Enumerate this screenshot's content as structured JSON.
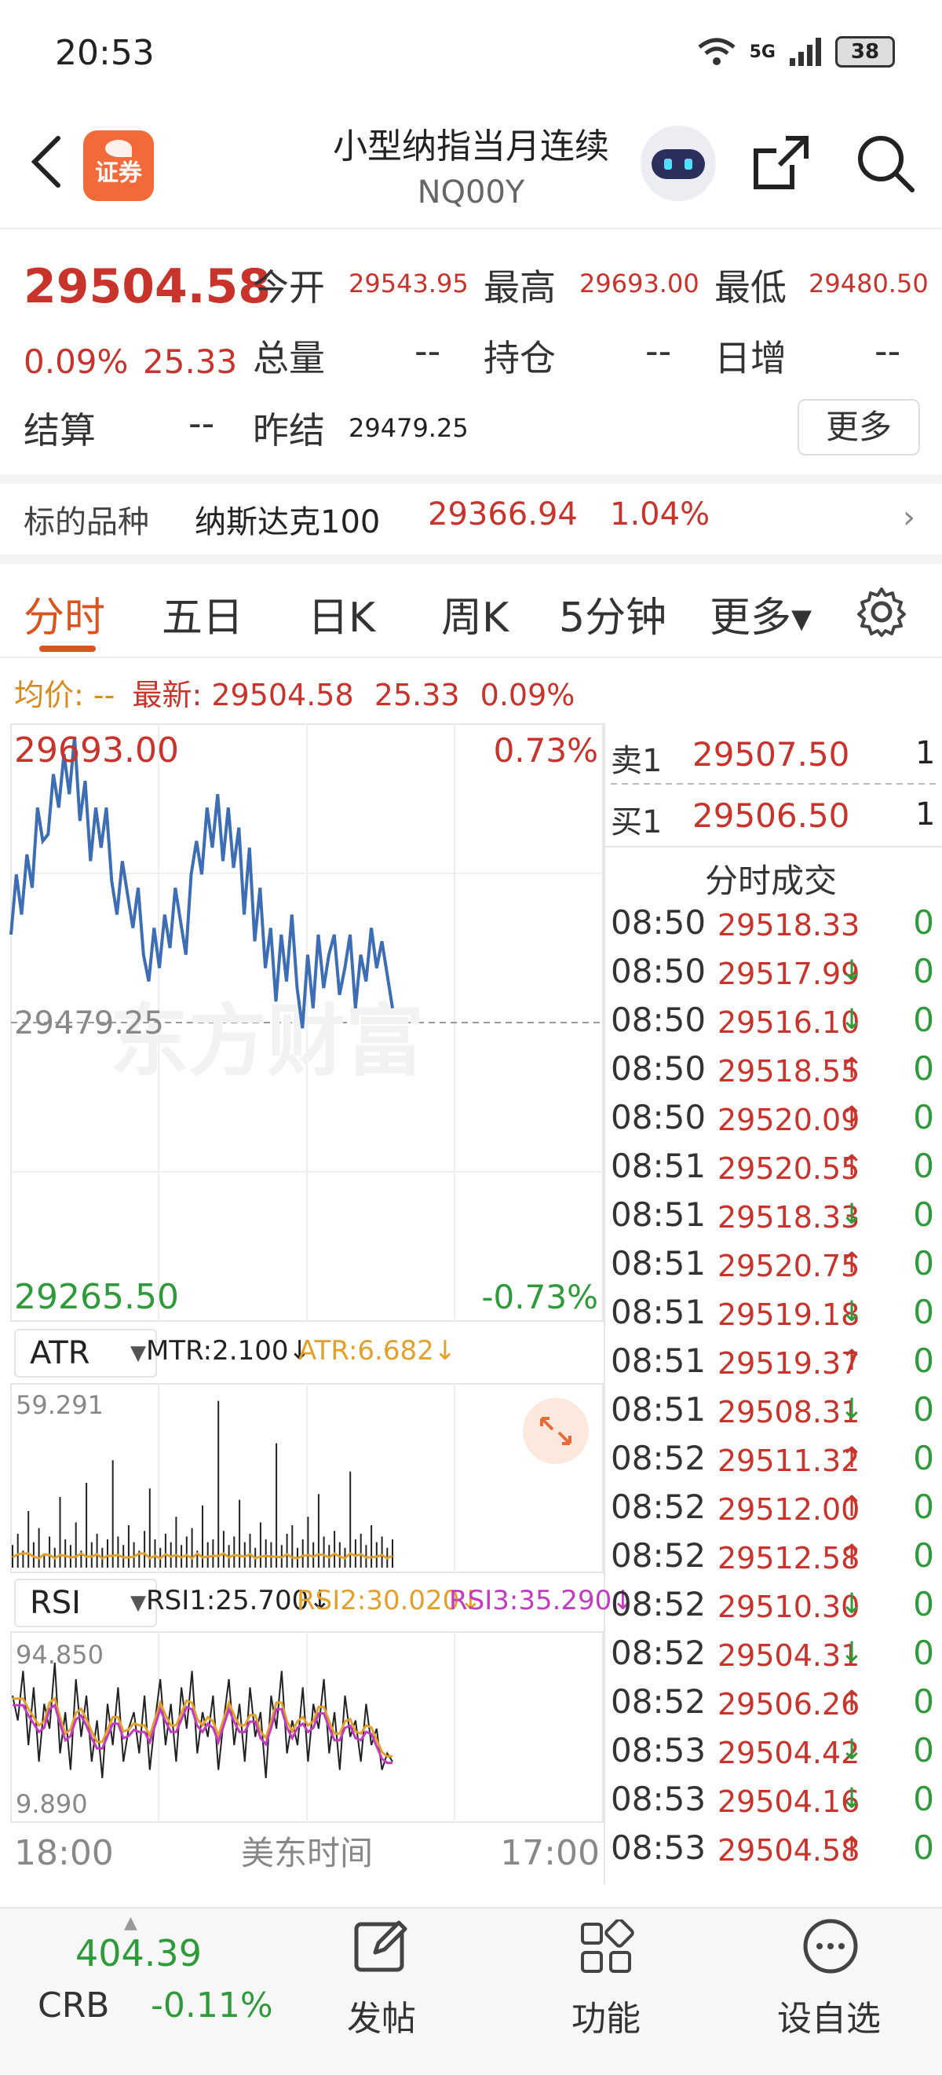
{
  "status_bar": {
    "time": "20:53",
    "network": "5G",
    "battery": "38"
  },
  "header": {
    "title": "小型纳指当月连续",
    "code": "NQ00Y",
    "app_logo_text": "证券"
  },
  "quote": {
    "price": "29504.58",
    "change_pct": "0.09%",
    "change": "25.33",
    "open_label": "今开",
    "open": "29543.95",
    "high_label": "最高",
    "high": "29693.00",
    "low_label": "最低",
    "low": "29480.50",
    "volume_label": "总量",
    "volume": "--",
    "oi_label": "持仓",
    "oi": "--",
    "daily_inc_label": "日增",
    "daily_inc": "--",
    "settle_label": "结算",
    "settle": "--",
    "prev_settle_label": "昨结",
    "prev_settle": "29479.25",
    "more_button": "更多"
  },
  "underlying": {
    "label": "标的品种",
    "name": "纳斯达克100",
    "price": "29366.94",
    "pct": "1.04%"
  },
  "tabs": [
    {
      "label": "分时",
      "active": true
    },
    {
      "label": "五日"
    },
    {
      "label": "日K"
    },
    {
      "label": "周K"
    },
    {
      "label": "5分钟"
    },
    {
      "label": "更多▾"
    }
  ],
  "info_line": {
    "avg_label": "均价:",
    "avg_value": "--",
    "latest_label": "最新:",
    "latest_value": "29504.58",
    "change": "25.33",
    "pct": "0.09%"
  },
  "chart": {
    "max_label": "29693.00",
    "max_pct": "0.73%",
    "ref_label": "29479.25",
    "min_label": "29265.50",
    "min_pct": "-0.73%",
    "watermark": "东方财富",
    "time_start": "18:00",
    "time_mid": "美东时间",
    "time_end": "17:00"
  },
  "chart_data": {
    "type": "line",
    "title": "",
    "xlabel": "美东时间",
    "ylim": [
      29265.5,
      29693.0
    ],
    "reference": 29479.25,
    "x_ticks": [
      "18:00",
      "17:00"
    ],
    "series": [
      {
        "values": [
          29545,
          29590,
          29560,
          29605,
          29580,
          29640,
          29615,
          29620,
          29665,
          29640,
          29680,
          29650,
          29693,
          29630,
          29660,
          29600,
          29640,
          29610,
          29640,
          29585,
          29560,
          29600,
          29575,
          29550,
          29580,
          29530,
          29510,
          29550,
          29520,
          29560,
          29535,
          29580,
          29555,
          29530,
          29590,
          29615,
          29590,
          29640,
          29610,
          29650,
          29600,
          29640,
          29595,
          29625,
          29560,
          29610,
          29540,
          29580,
          29520,
          29550,
          29495,
          29545,
          29510,
          29560,
          29505,
          29475,
          29530,
          29490,
          29545,
          29505,
          29530,
          29545,
          29500,
          29520,
          29545,
          29490,
          29530,
          29510,
          29550,
          29520,
          29540,
          29515,
          29490
        ]
      }
    ]
  },
  "atr": {
    "selector": "ATR",
    "mtr_label": "MTR:2.100↓",
    "atr_label": "ATR:6.682↓",
    "top_value": "59.291",
    "values": [
      8,
      12,
      6,
      20,
      9,
      14,
      5,
      11,
      7,
      25,
      10,
      8,
      16,
      6,
      30,
      9,
      12,
      7,
      10,
      38,
      11,
      8,
      15,
      9,
      6,
      13,
      28,
      10,
      7,
      12,
      9,
      18,
      8,
      11,
      14,
      6,
      22,
      9,
      10,
      59,
      13,
      8,
      11,
      24,
      9,
      12,
      7,
      16,
      10,
      9,
      44,
      8,
      12,
      15,
      7,
      10,
      18,
      9,
      26,
      11,
      8,
      13,
      9,
      7,
      34,
      10,
      12,
      8,
      15,
      9,
      11,
      7,
      10
    ]
  },
  "rsi": {
    "selector": "RSI",
    "rsi1_label": "RSI1:25.700↓",
    "rsi2_label": "RSI2:30.020↓",
    "rsi3_label": "RSI3:35.290↓",
    "top_value": "94.850",
    "bottom_value": "9.890",
    "values": [
      70,
      55,
      85,
      40,
      75,
      30,
      65,
      50,
      90,
      35,
      60,
      25,
      80,
      45,
      70,
      30,
      55,
      20,
      65,
      40,
      75,
      30,
      50,
      60,
      35,
      70,
      25,
      55,
      80,
      40,
      65,
      30,
      75,
      50,
      85,
      35,
      60,
      45,
      70,
      25,
      55,
      80,
      40,
      65,
      30,
      75,
      45,
      60,
      20,
      70,
      50,
      85,
      35,
      55,
      40,
      75,
      30,
      65,
      50,
      80,
      35,
      60,
      25,
      70,
      45,
      55,
      30,
      65,
      40,
      50,
      25,
      35,
      30
    ]
  },
  "order_book": {
    "sell_label": "卖1",
    "sell_price": "29507.50",
    "sell_vol": "1",
    "buy_label": "买1",
    "buy_price": "29506.50",
    "buy_vol": "1"
  },
  "trades": {
    "title": "分时成交",
    "rows": [
      {
        "time": "08:50",
        "price": "29518.33",
        "dir": "",
        "vol": "0"
      },
      {
        "time": "08:50",
        "price": "29517.99",
        "dir": "↓",
        "vol": "0"
      },
      {
        "time": "08:50",
        "price": "29516.10",
        "dir": "↓",
        "vol": "0"
      },
      {
        "time": "08:50",
        "price": "29518.55",
        "dir": "↑",
        "vol": "0"
      },
      {
        "time": "08:50",
        "price": "29520.09",
        "dir": "↑",
        "vol": "0"
      },
      {
        "time": "08:51",
        "price": "29520.55",
        "dir": "↑",
        "vol": "0"
      },
      {
        "time": "08:51",
        "price": "29518.33",
        "dir": "↓",
        "vol": "0"
      },
      {
        "time": "08:51",
        "price": "29520.75",
        "dir": "↑",
        "vol": "0"
      },
      {
        "time": "08:51",
        "price": "29519.18",
        "dir": "↓",
        "vol": "0"
      },
      {
        "time": "08:51",
        "price": "29519.37",
        "dir": "↑",
        "vol": "0"
      },
      {
        "time": "08:51",
        "price": "29508.31",
        "dir": "↓",
        "vol": "0"
      },
      {
        "time": "08:52",
        "price": "29511.32",
        "dir": "↑",
        "vol": "0"
      },
      {
        "time": "08:52",
        "price": "29512.00",
        "dir": "↑",
        "vol": "0"
      },
      {
        "time": "08:52",
        "price": "29512.58",
        "dir": "↑",
        "vol": "0"
      },
      {
        "time": "08:52",
        "price": "29510.30",
        "dir": "↓",
        "vol": "0"
      },
      {
        "time": "08:52",
        "price": "29504.31",
        "dir": "↓",
        "vol": "0"
      },
      {
        "time": "08:52",
        "price": "29506.26",
        "dir": "↑",
        "vol": "0"
      },
      {
        "time": "08:53",
        "price": "29504.42",
        "dir": "↓",
        "vol": "0"
      },
      {
        "time": "08:53",
        "price": "29504.16",
        "dir": "↓",
        "vol": "0"
      },
      {
        "time": "08:53",
        "price": "29504.58",
        "dir": "↑",
        "vol": "0"
      }
    ]
  },
  "bottom_bar": {
    "crb_price": "404.39",
    "crb_name": "CRB",
    "crb_pct": "-0.11%",
    "post_label": "发帖",
    "func_label": "功能",
    "watch_label": "设自选"
  },
  "colors": {
    "red": "#c8332b",
    "green": "#2f9a3a",
    "accent": "#d9541e",
    "line": "#3d6eb5",
    "atr2": "#e3a02b",
    "rsi3": "#c23cc0"
  }
}
